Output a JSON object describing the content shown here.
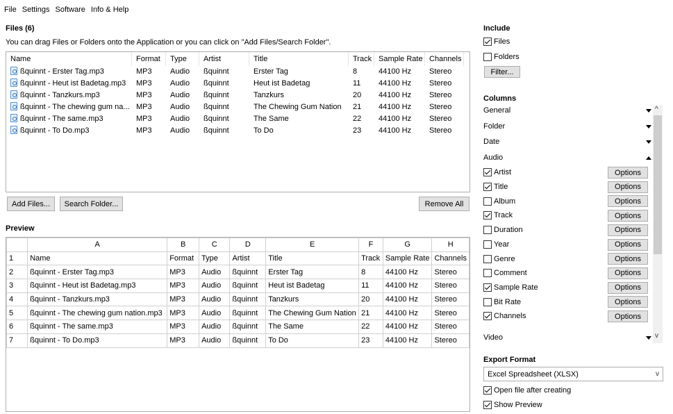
{
  "menu": [
    "File",
    "Settings",
    "Software",
    "Info & Help"
  ],
  "files": {
    "title": "Files (6)",
    "hint": "You can drag Files or Folders onto the Application or you can click on \"Add Files/Search Folder\".",
    "columns": [
      "Name",
      "Format",
      "Type",
      "Artist",
      "Title",
      "Track",
      "Sample Rate",
      "Channels"
    ],
    "rows": [
      [
        "ßquinnt - Erster Tag.mp3",
        "MP3",
        "Audio",
        "ßquinnt",
        "Erster Tag",
        "8",
        "44100 Hz",
        "Stereo"
      ],
      [
        "ßquinnt - Heut ist Badetag.mp3",
        "MP3",
        "Audio",
        "ßquinnt",
        "Heut ist Badetag",
        "11",
        "44100 Hz",
        "Stereo"
      ],
      [
        "ßquinnt - Tanzkurs.mp3",
        "MP3",
        "Audio",
        "ßquinnt",
        "Tanzkurs",
        "20",
        "44100 Hz",
        "Stereo"
      ],
      [
        "ßquinnt - The chewing gum na...",
        "MP3",
        "Audio",
        "ßquinnt",
        "The Chewing Gum Nation",
        "21",
        "44100 Hz",
        "Stereo"
      ],
      [
        "ßquinnt - The same.mp3",
        "MP3",
        "Audio",
        "ßquinnt",
        "The Same",
        "22",
        "44100 Hz",
        "Stereo"
      ],
      [
        "ßquinnt - To Do.mp3",
        "MP3",
        "Audio",
        "ßquinnt",
        "To Do",
        "23",
        "44100 Hz",
        "Stereo"
      ]
    ],
    "add_files": "Add Files...",
    "search_folder": "Search Folder...",
    "remove_all": "Remove All"
  },
  "preview": {
    "title": "Preview",
    "col_letters": [
      "A",
      "B",
      "C",
      "D",
      "E",
      "F",
      "G",
      "H"
    ],
    "rows": [
      [
        "1",
        "Name",
        "Format",
        "Type",
        "Artist",
        "Title",
        "Track",
        "Sample Rate",
        "Channels"
      ],
      [
        "2",
        "ßquinnt - Erster Tag.mp3",
        "MP3",
        "Audio",
        "ßquinnt",
        "Erster Tag",
        "8",
        "44100 Hz",
        "Stereo"
      ],
      [
        "3",
        "ßquinnt - Heut ist Badetag.mp3",
        "MP3",
        "Audio",
        "ßquinnt",
        "Heut ist Badetag",
        "11",
        "44100 Hz",
        "Stereo"
      ],
      [
        "4",
        "ßquinnt - Tanzkurs.mp3",
        "MP3",
        "Audio",
        "ßquinnt",
        "Tanzkurs",
        "20",
        "44100 Hz",
        "Stereo"
      ],
      [
        "5",
        "ßquinnt - The chewing gum nation.mp3",
        "MP3",
        "Audio",
        "ßquinnt",
        "The Chewing Gum Nation",
        "21",
        "44100 Hz",
        "Stereo"
      ],
      [
        "6",
        "ßquinnt - The same.mp3",
        "MP3",
        "Audio",
        "ßquinnt",
        "The Same",
        "22",
        "44100 Hz",
        "Stereo"
      ],
      [
        "7",
        "ßquinnt - To Do.mp3",
        "MP3",
        "Audio",
        "ßquinnt",
        "To Do",
        "23",
        "44100 Hz",
        "Stereo"
      ]
    ]
  },
  "include": {
    "title": "Include",
    "files_label": "Files",
    "files_checked": true,
    "folders_label": "Folders",
    "folders_checked": false,
    "filter": "Filter..."
  },
  "columns_panel": {
    "title": "Columns",
    "general": "General",
    "folder": "Folder",
    "date": "Date",
    "audio": "Audio",
    "video": "Video",
    "options_label": "Options",
    "audio_items": [
      {
        "label": "Artist",
        "checked": true
      },
      {
        "label": "Title",
        "checked": true
      },
      {
        "label": "Album",
        "checked": false
      },
      {
        "label": "Track",
        "checked": true
      },
      {
        "label": "Duration",
        "checked": false
      },
      {
        "label": "Year",
        "checked": false
      },
      {
        "label": "Genre",
        "checked": false
      },
      {
        "label": "Comment",
        "checked": false
      },
      {
        "label": "Sample Rate",
        "checked": true
      },
      {
        "label": "Bit Rate",
        "checked": false
      },
      {
        "label": "Channels",
        "checked": true
      }
    ]
  },
  "export": {
    "title": "Export Format",
    "selected": "Excel Spreadsheet (XLSX)",
    "open_after": "Open file after creating",
    "open_after_checked": true,
    "show_preview": "Show Preview",
    "show_preview_checked": true
  }
}
